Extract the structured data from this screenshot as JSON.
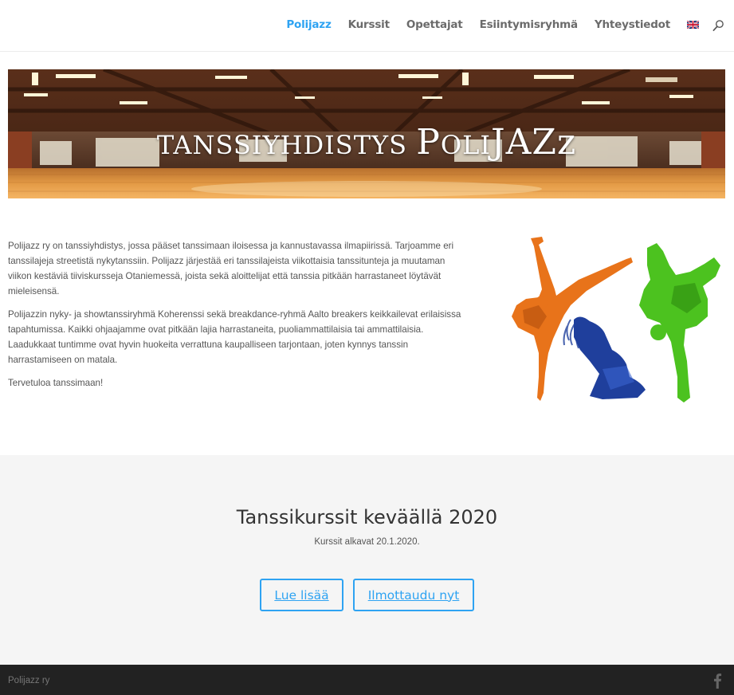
{
  "nav": {
    "items": [
      {
        "label": "Polijazz"
      },
      {
        "label": "Kurssit"
      },
      {
        "label": "Opettajat"
      },
      {
        "label": "Esiintymisryhmä"
      },
      {
        "label": "Yhteystiedot"
      }
    ],
    "active_color": "#2ea3f2",
    "language_icon": "uk-flag-icon",
    "search_icon": "search-icon"
  },
  "banner": {
    "title_part1": "TANSSIYHDISTYS ",
    "title_p": "P",
    "title_oli": "OLI",
    "title_ja": "JA",
    "title_zz": "Zz"
  },
  "intro": {
    "p1": "Polijazz ry on tanssiyhdistys, jossa pääset tanssimaan iloisessa ja kannustavassa ilmapiirissä. Tarjoamme eri tanssilajeja streetistä nykytanssiin. Polijazz järjestää eri tanssilajeista viikottaisia tanssitunteja ja muutaman viikon kestäviä tiiviskursseja Otaniemessä, joista sekä aloittelijat että tanssia pitkään harrastaneet löytävät mieleisensä.",
    "p2": "Polijazzin nyky- ja showtanssiryhmä Koherenssi sekä breakdance-ryhmä Aalto breakers keikkailevat erilaisissa tapahtumissa. Kaikki ohjaajamme ovat pitkään lajia harrastaneita, puoliammattilaisia tai ammattilaisia. Laadukkaat tuntimme ovat hyvin huokeita verrattuna kaupalliseen tarjontaan, joten kynnys tanssin harrastamiseen on matala.",
    "p3": "Tervetuloa tanssimaan!"
  },
  "courses": {
    "title": "Tanssikurssit keväällä 2020",
    "subtitle": "Kurssit alkavat 20.1.2020.",
    "read_more_label": "Lue lisää",
    "register_label": "Ilmottaudu nyt"
  },
  "footer": {
    "copyright": "Polijazz ry",
    "social_icon": "facebook-icon"
  },
  "colors": {
    "accent": "#2ea3f2",
    "footer_bg": "#222222",
    "section_bg": "#f5f5f5",
    "dancer_orange": "#e8731a",
    "dancer_blue": "#1f3f9c",
    "dancer_green": "#4cc21f"
  }
}
